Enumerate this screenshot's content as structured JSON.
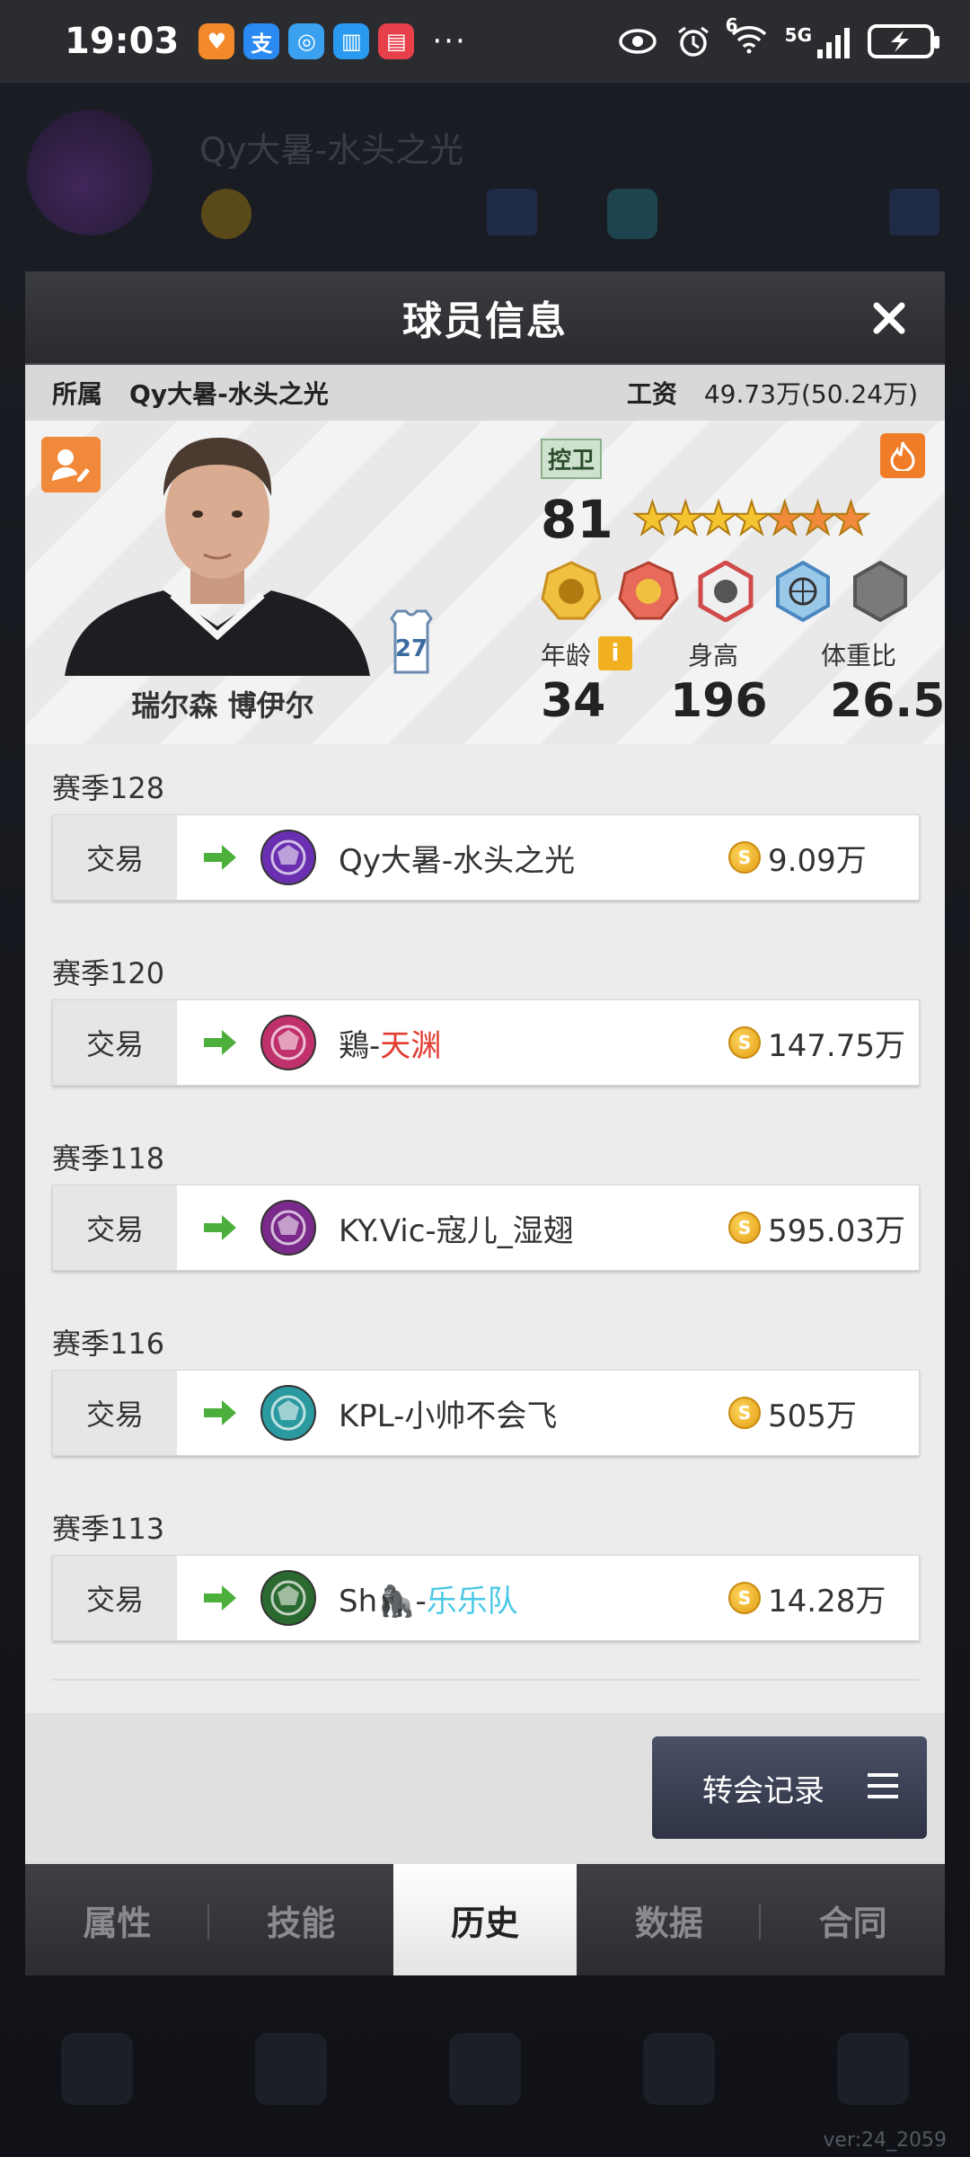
{
  "status_bar": {
    "time": "19:03",
    "network_labels": [
      "6",
      "5G"
    ],
    "more": "···"
  },
  "modal": {
    "title": "球员信息",
    "info": {
      "affiliation_label": "所属",
      "team": "Qy大暑-水头之光",
      "salary_label": "工资",
      "salary": "49.73万(50.24万)"
    },
    "player": {
      "name": "瑞尔森 博伊尔",
      "jersey_number": "27",
      "position": "控卫",
      "rating": "81",
      "stars": 7,
      "age_label": "年龄",
      "height_label": "身高",
      "weight_ratio_label": "体重比",
      "info_icon": "i",
      "age": "34",
      "height": "196",
      "weight_ratio": "26.5"
    },
    "history": [
      {
        "season": "赛季128",
        "type": "交易",
        "team_prefix": "Qy大暑-水头之光",
        "team_suffix": "",
        "suffix_color": "",
        "price": "9.09万",
        "logo_color": "#6a2fb0"
      },
      {
        "season": "赛季120",
        "type": "交易",
        "team_prefix": "鶏-",
        "team_suffix": "天渊",
        "suffix_color": "#e23b30",
        "price": "147.75万",
        "logo_color": "#c0306a"
      },
      {
        "season": "赛季118",
        "type": "交易",
        "team_prefix": "KY.Vic-寇儿_湿翅",
        "team_suffix": "",
        "suffix_color": "",
        "price": "595.03万",
        "logo_color": "#7a2a8a"
      },
      {
        "season": "赛季116",
        "type": "交易",
        "team_prefix": "KPL-小帅不会飞",
        "team_suffix": "",
        "suffix_color": "",
        "price": "505万",
        "logo_color": "#2a9aa0"
      },
      {
        "season": "赛季113",
        "type": "交易",
        "team_prefix": "Sh🦍-",
        "team_suffix": "乐乐队",
        "suffix_color": "#4cc9e6",
        "price": "14.28万",
        "logo_color": "#2a6a30"
      }
    ],
    "transfer_button": "转会记录",
    "tabs": [
      "属性",
      "技能",
      "历史",
      "数据",
      "合同"
    ],
    "active_tab": "历史"
  },
  "version": "ver:24_2059",
  "colors": {
    "accent_orange": "#f08a3a",
    "arrow_green": "#4caf3c",
    "red_text": "#e23b30",
    "cyan_text": "#4cc9e6"
  }
}
